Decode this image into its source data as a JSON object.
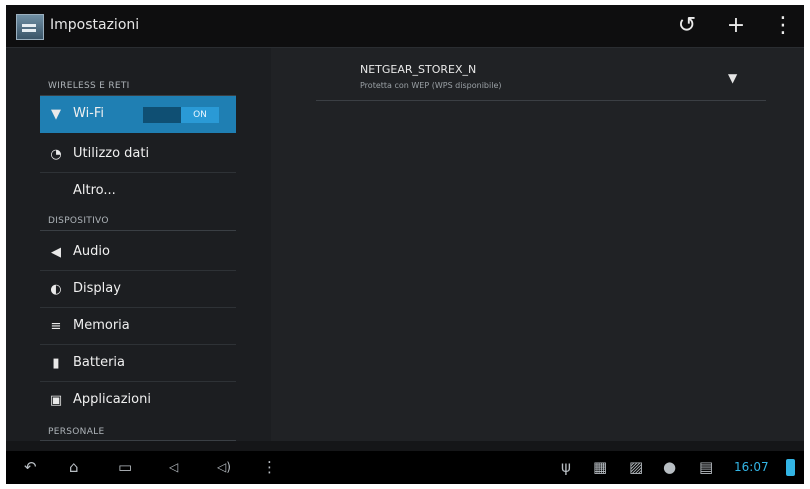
{
  "actionbar": {
    "title": "Impostazioni",
    "buttons": [
      {
        "icon": "refresh-icon",
        "glyph": "↺"
      },
      {
        "icon": "add-icon",
        "glyph": "+"
      },
      {
        "icon": "overflow-menu-icon",
        "glyph": "⋮"
      }
    ]
  },
  "sidebar": {
    "sections": [
      "WIRELESS E RETI",
      "DISPOSITIVO",
      "PERSONALE"
    ],
    "items": [
      {
        "label": "Wi-Fi",
        "icon": "wifi-icon",
        "glyph": "▼"
      },
      {
        "label": "Utilizzo dati",
        "icon": "data-usage-icon",
        "glyph": "◔"
      },
      {
        "label": "Altro...",
        "icon": "",
        "glyph": ""
      },
      {
        "label": "Audio",
        "icon": "speaker-icon",
        "glyph": "◀"
      },
      {
        "label": "Display",
        "icon": "brightness-icon",
        "glyph": "◐"
      },
      {
        "label": "Memoria",
        "icon": "storage-icon",
        "glyph": "≡"
      },
      {
        "label": "Batteria",
        "icon": "battery-icon",
        "glyph": "▮"
      },
      {
        "label": "Applicazioni",
        "icon": "apps-icon",
        "glyph": "▣"
      }
    ],
    "wifi_toggle": "ON"
  },
  "network": {
    "name": "NETGEAR_STOREX_N",
    "status": "Protetta con WEP (WPS disponibile)"
  },
  "systembar": {
    "clock": "16:07"
  }
}
